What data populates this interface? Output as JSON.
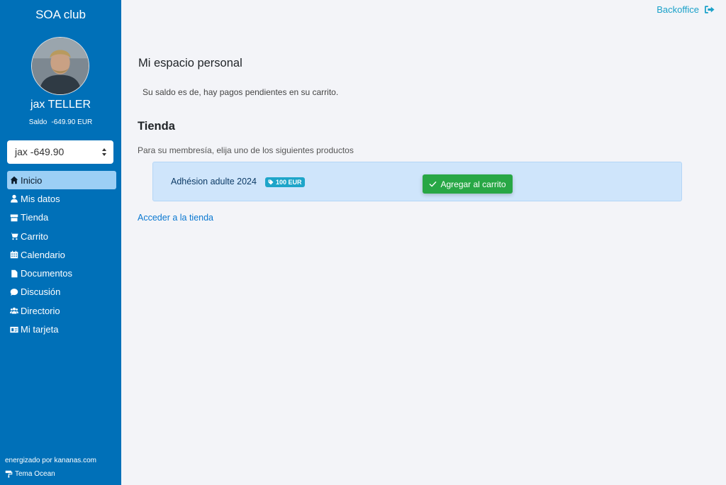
{
  "sidebar": {
    "club_title": "SOA club",
    "user_name": "jax TELLER",
    "balance_label": "Saldo",
    "balance_value": "-649.90 EUR",
    "account_select_value": "jax -649.90",
    "items": [
      {
        "label": "Inicio",
        "icon": "home-icon",
        "active": true
      },
      {
        "label": "Mis datos",
        "icon": "user-icon"
      },
      {
        "label": "Tienda",
        "icon": "store-icon"
      },
      {
        "label": "Carrito",
        "icon": "cart-icon"
      },
      {
        "label": "Calendario",
        "icon": "calendar-icon"
      },
      {
        "label": "Documentos",
        "icon": "document-icon"
      },
      {
        "label": "Discusión",
        "icon": "chat-icon"
      },
      {
        "label": "Directorio",
        "icon": "users-icon"
      },
      {
        "label": "Mi tarjeta",
        "icon": "id-card-icon"
      }
    ],
    "powered_by": "energizado por kananas.com",
    "theme_label": "Tema Ocean"
  },
  "header": {
    "backoffice_label": "Backoffice"
  },
  "main": {
    "personal_title": "Mi espacio personal",
    "saldo_message": "Su saldo es de, hay pagos pendientes en su carrito.",
    "tienda_title": "Tienda",
    "membership_message": "Para su membresía, elija uno de los siguientes productos",
    "product": {
      "name": "Adhésion adulte 2024",
      "price": "100 EUR",
      "add_button": "Agregar al carrito"
    },
    "shop_link": "Acceder a la tienda"
  },
  "colors": {
    "sidebar_bg": "#0070b8",
    "active_item_bg": "#9ccff5",
    "accent_teal": "#1aa1c9",
    "success_green": "#28a745",
    "link_blue": "#0a78d1"
  }
}
